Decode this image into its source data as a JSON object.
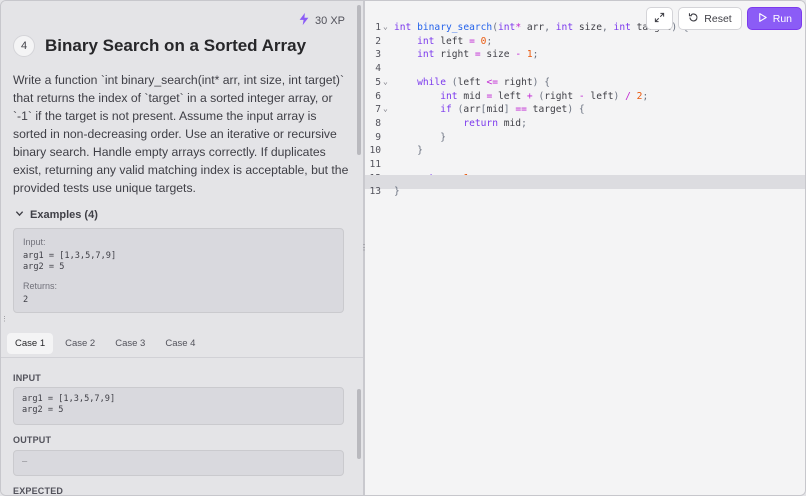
{
  "xp": "30 XP",
  "question": {
    "number": "4",
    "title": "Binary Search on a Sorted Array",
    "description": "Write a function `int binary_search(int* arr, int size, int target)` that returns the index of `target` in a sorted integer array, or `-1` if the target is not present. Assume the input array is sorted in non-decreasing order. Use an iterative or recursive binary search. Handle empty arrays correctly. If duplicates exist, returning any valid matching index is acceptable, but the provided tests use unique targets."
  },
  "examples": {
    "toggle_label": "Examples (4)",
    "input_label": "Input:",
    "arg1": "arg1 = [1,3,5,7,9]",
    "arg2": "arg2 = 5",
    "returns_label": "Returns:",
    "returns": "2"
  },
  "tabs": [
    "Case 1",
    "Case 2",
    "Case 3",
    "Case 4"
  ],
  "testcase": {
    "input_label": "INPUT",
    "arg1": "arg1 = [1,3,5,7,9]",
    "arg2": "arg2 = 5",
    "output_label": "OUTPUT",
    "output_value": "–",
    "expected_label": "EXPECTED"
  },
  "toolbar": {
    "reset_label": "Reset",
    "run_label": "Run"
  },
  "code": {
    "lines": [
      "1",
      "2",
      "3",
      "4",
      "5",
      "6",
      "7",
      "8",
      "9",
      "10",
      "11",
      "12",
      "13"
    ]
  },
  "colors": {
    "accent": "#8b5cf6",
    "keyword": "#7c3aed",
    "function": "#2563eb",
    "number": "#ea580c"
  }
}
